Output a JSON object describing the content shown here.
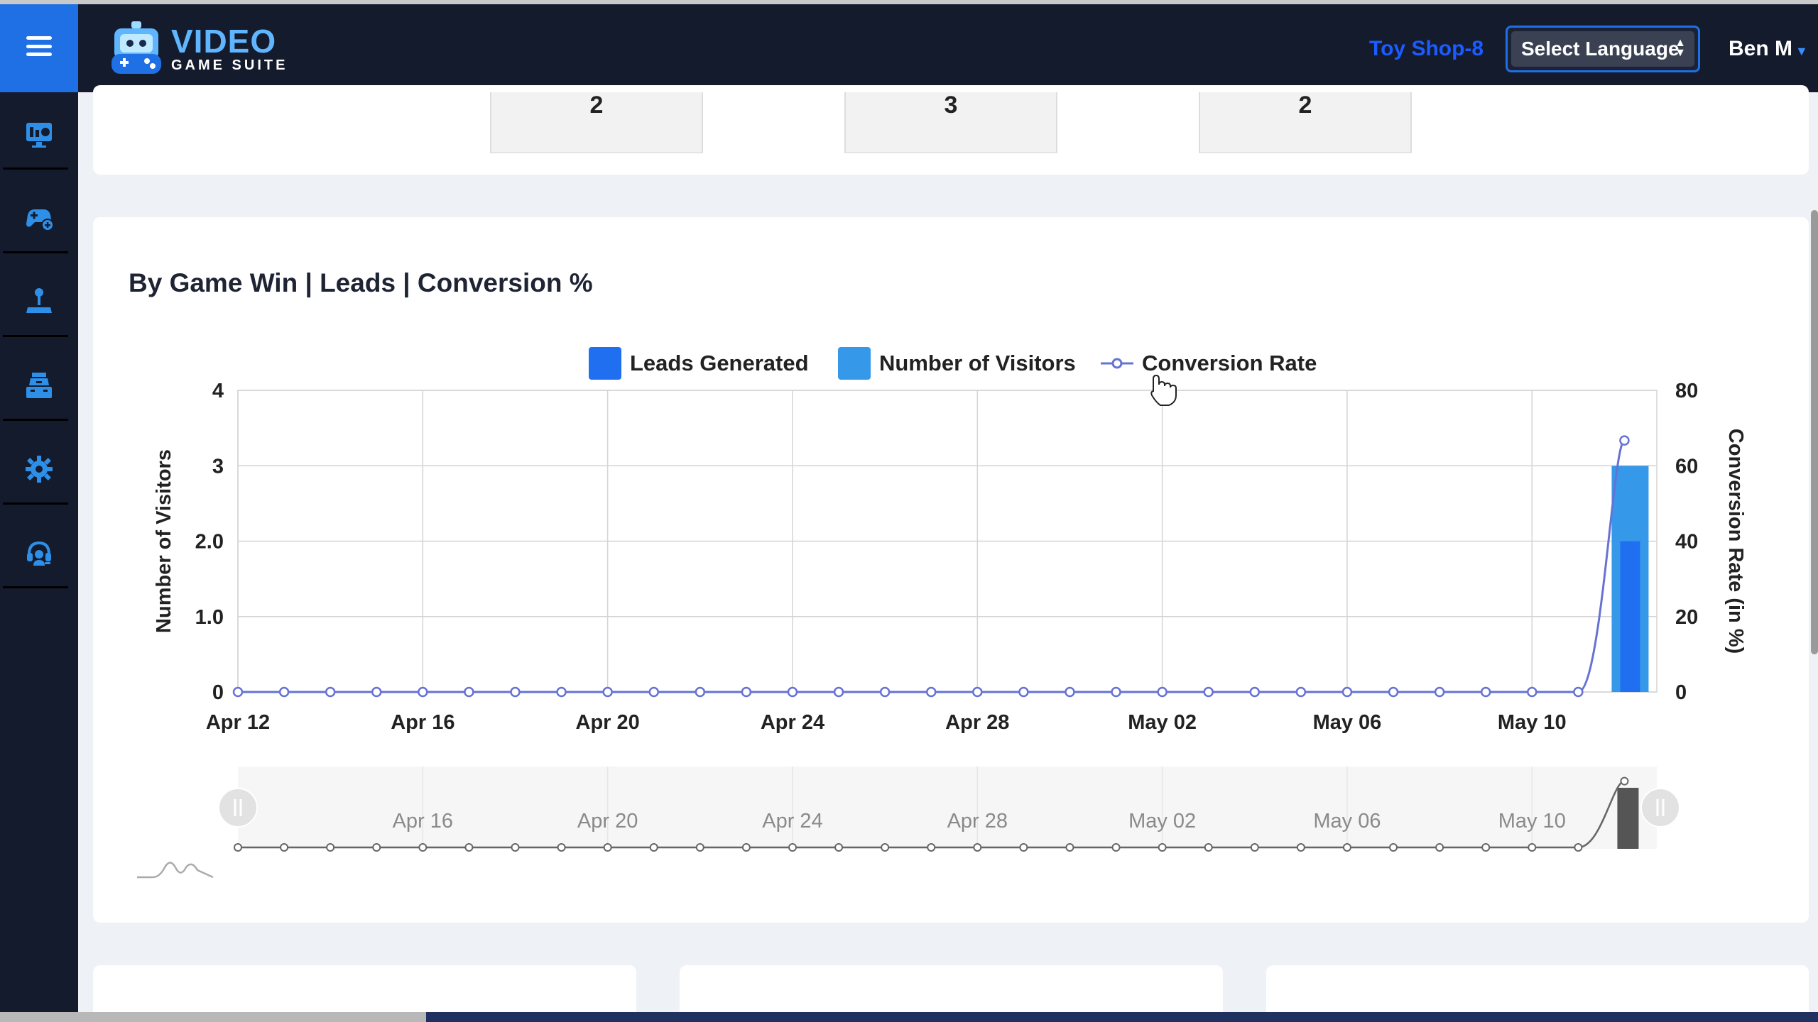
{
  "header": {
    "logo_title": "VIDEO",
    "logo_subtitle": "GAME SUITE",
    "shop_name": "Toy Shop-8",
    "language_select": "Select Language",
    "user_name": "Ben M"
  },
  "sidebar": {
    "items": [
      {
        "icon": "monitor-chart-icon"
      },
      {
        "icon": "gamepad-add-icon"
      },
      {
        "icon": "joystick-icon"
      },
      {
        "icon": "arcade-machine-icon"
      },
      {
        "icon": "gear-icon"
      },
      {
        "icon": "headset-support-icon"
      }
    ]
  },
  "stats": {
    "values": [
      "2",
      "3",
      "2"
    ]
  },
  "chart_card": {
    "title": "By Game Win | Leads | Conversion %"
  },
  "colors": {
    "leads": "#1f6ff0",
    "visitors": "#3598e9",
    "conversion": "#6672d4",
    "header_bg": "#141b2d",
    "accent": "#1f6fe5"
  },
  "chart_data": {
    "type": "bar",
    "legend": [
      "Leads Generated",
      "Number of Visitors",
      "Conversion Rate"
    ],
    "x_ticks": [
      "Apr 12",
      "Apr 16",
      "Apr 20",
      "Apr 24",
      "Apr 28",
      "May 02",
      "May 06",
      "May 10"
    ],
    "navigator_ticks": [
      "Apr 16",
      "Apr 20",
      "Apr 24",
      "Apr 28",
      "May 02",
      "May 06",
      "May 10"
    ],
    "x_range": [
      "2024-04-12",
      "2024-05-12"
    ],
    "ylabel": "Number of Visitors",
    "y2label": "Conversion Rate (in %)",
    "y_ticks": [
      "0",
      "1.0",
      "2.0",
      "3",
      "4"
    ],
    "y2_ticks": [
      "0",
      "20",
      "40",
      "60",
      "80"
    ],
    "ylim": [
      0,
      4
    ],
    "y2lim": [
      0,
      80
    ],
    "series": [
      {
        "name": "Leads Generated",
        "kind": "bar",
        "points": [
          {
            "date": "2024-05-12",
            "value": 2
          }
        ]
      },
      {
        "name": "Number of Visitors",
        "kind": "bar",
        "points": [
          {
            "date": "2024-05-12",
            "value": 3
          }
        ]
      },
      {
        "name": "Conversion Rate",
        "kind": "line",
        "dates": [
          "2024-04-12",
          "2024-04-13",
          "2024-04-14",
          "2024-04-15",
          "2024-04-16",
          "2024-04-17",
          "2024-04-18",
          "2024-04-19",
          "2024-04-20",
          "2024-04-21",
          "2024-04-22",
          "2024-04-23",
          "2024-04-24",
          "2024-04-25",
          "2024-04-26",
          "2024-04-27",
          "2024-04-28",
          "2024-04-29",
          "2024-04-30",
          "2024-05-01",
          "2024-05-02",
          "2024-05-03",
          "2024-05-04",
          "2024-05-05",
          "2024-05-06",
          "2024-05-07",
          "2024-05-08",
          "2024-05-09",
          "2024-05-10",
          "2024-05-11",
          "2024-05-12"
        ],
        "values": [
          0,
          0,
          0,
          0,
          0,
          0,
          0,
          0,
          0,
          0,
          0,
          0,
          0,
          0,
          0,
          0,
          0,
          0,
          0,
          0,
          0,
          0,
          0,
          0,
          0,
          0,
          0,
          0,
          0,
          0,
          66.7
        ]
      }
    ],
    "grid": true
  }
}
